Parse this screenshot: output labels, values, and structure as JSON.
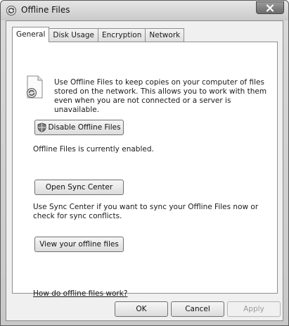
{
  "window": {
    "title": "Offline Files",
    "title_icon": "offline-files-icon",
    "close_icon": "close-icon"
  },
  "tabs": [
    {
      "label": "General",
      "active": true
    },
    {
      "label": "Disk Usage",
      "active": false
    },
    {
      "label": "Encryption",
      "active": false
    },
    {
      "label": "Network",
      "active": false
    }
  ],
  "general": {
    "intro_text": "Use Offline Files to keep copies on your computer of files stored on the network.  This allows you to work with them even when you are not connected or a server is unavailable.",
    "disable_button": "Disable Offline Files",
    "status_text": "Offline Files is currently enabled.",
    "sync_center_button": "Open Sync Center",
    "sync_description": "Use Sync Center if you want to sync your Offline Files now or check for sync conflicts.",
    "view_files_button": "View your offline files",
    "help_link": "How do offline files work?"
  },
  "footer": {
    "ok": "OK",
    "cancel": "Cancel",
    "apply": "Apply"
  }
}
